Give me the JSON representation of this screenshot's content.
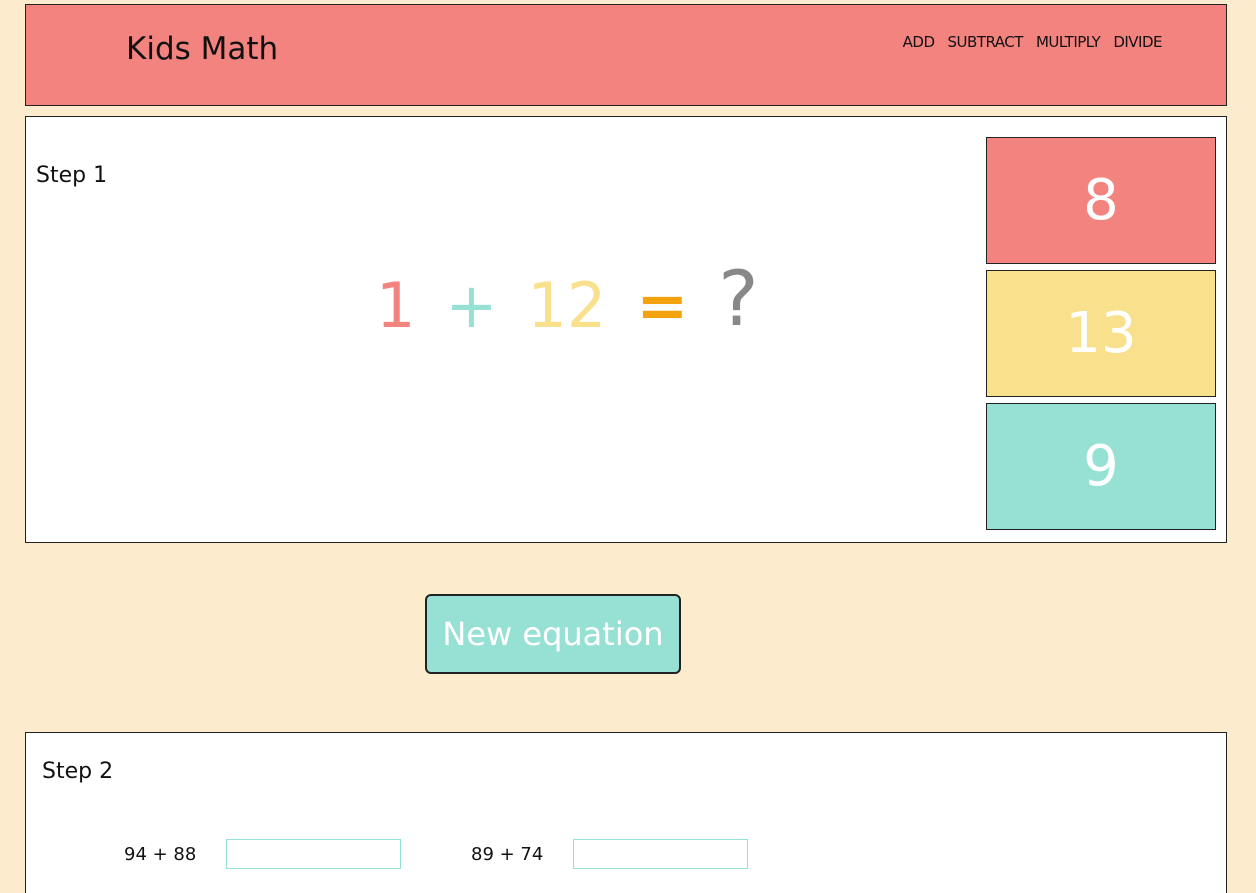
{
  "header": {
    "brand": "Kids Math",
    "nav": [
      "ADD",
      "SUBTRACT",
      "MULTIPLY",
      "DIVIDE"
    ]
  },
  "step1": {
    "title": "Step 1",
    "equation": {
      "left": "1",
      "operator": "+",
      "right": "12",
      "equals": "=",
      "result": "?"
    },
    "answers": [
      {
        "value": "8",
        "color": "#f3837f"
      },
      {
        "value": "13",
        "color": "#f9e08c"
      },
      {
        "value": "9",
        "color": "#96e0d4"
      }
    ]
  },
  "new_equation_button": "New equation",
  "step2": {
    "title": "Step 2",
    "problems": [
      {
        "expr": "94 + 88",
        "value": ""
      },
      {
        "expr": "89 + 74",
        "value": ""
      }
    ]
  },
  "colors": {
    "background": "#fdebcd",
    "coral": "#f3837f",
    "yellow": "#f9e08c",
    "mint": "#96e0d4",
    "orange": "#f4a20d",
    "gray": "#888888"
  }
}
